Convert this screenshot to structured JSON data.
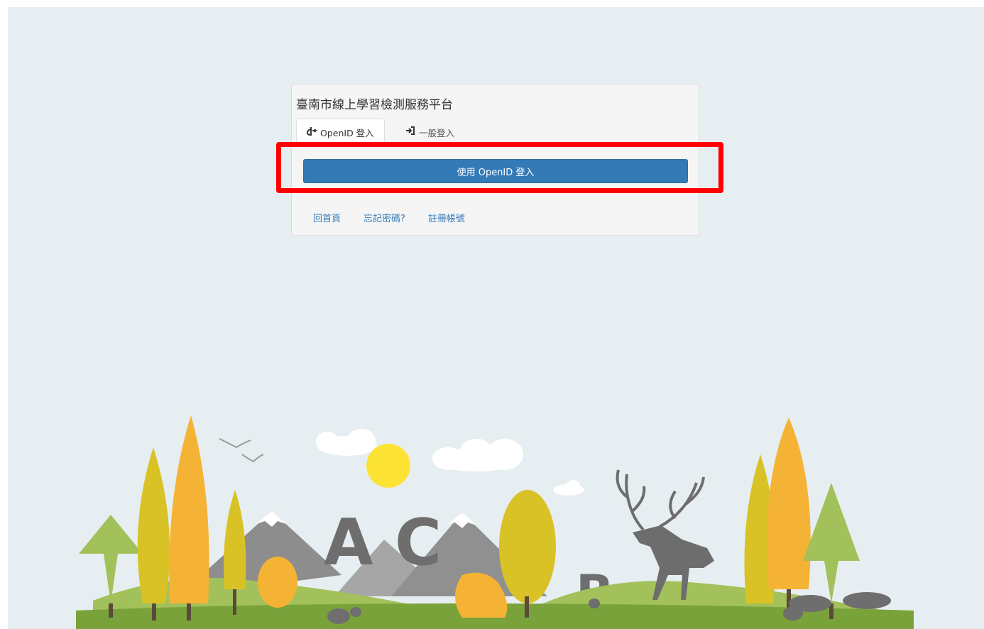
{
  "panel": {
    "title": "臺南市線上學習檢測服務平台",
    "tabs": [
      {
        "label": "OpenID 登入",
        "icon": "openid-icon",
        "active": true
      },
      {
        "label": "一般登入",
        "icon": "sign-in-icon",
        "active": false
      }
    ],
    "primary_button": "使用 OpenID 登入",
    "links": [
      "回首頁",
      "忘記密碼?",
      "註冊帳號"
    ]
  },
  "illustration": {
    "letters": [
      "A",
      "C",
      "B"
    ]
  },
  "colors": {
    "background": "#e7eef1",
    "button": "#337ab7",
    "link": "#337ab7",
    "highlight": "#ff0000"
  }
}
